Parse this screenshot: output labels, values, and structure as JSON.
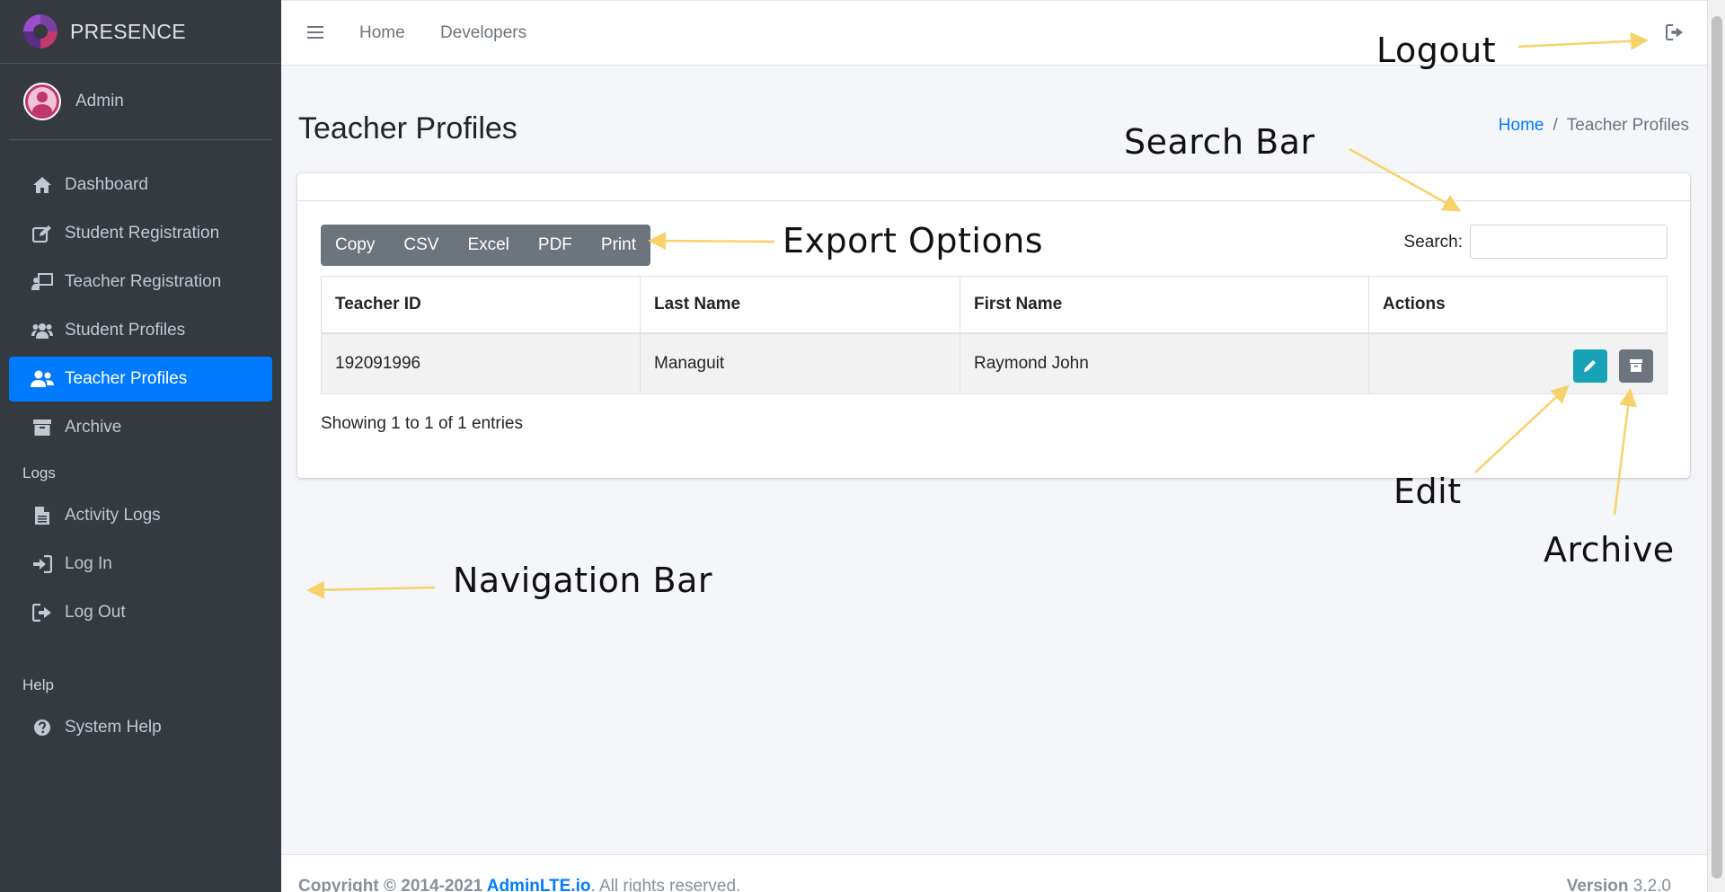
{
  "sidebar": {
    "brand": "PRESENCE",
    "user": "Admin",
    "items": [
      {
        "label": "Dashboard",
        "icon": "home-icon"
      },
      {
        "label": "Student Registration",
        "icon": "edit-icon"
      },
      {
        "label": "Teacher Registration",
        "icon": "chalkboard-teacher-icon"
      },
      {
        "label": "Student Profiles",
        "icon": "users-icon"
      },
      {
        "label": "Teacher Profiles",
        "icon": "user-friends-icon",
        "active": true
      },
      {
        "label": "Archive",
        "icon": "archive-icon"
      }
    ],
    "logs_header": "Logs",
    "logs_items": [
      {
        "label": "Activity Logs",
        "icon": "file-icon"
      },
      {
        "label": "Log In",
        "icon": "sign-in-icon"
      },
      {
        "label": "Log Out",
        "icon": "sign-out-icon"
      }
    ],
    "help_header": "Help",
    "help_items": [
      {
        "label": "System Help",
        "icon": "question-circle-icon"
      }
    ]
  },
  "topbar": {
    "links": [
      "Home",
      "Developers"
    ]
  },
  "page": {
    "title": "Teacher Profiles",
    "breadcrumb": [
      "Home",
      "Teacher Profiles"
    ],
    "breadcrumb_sep": "/"
  },
  "export_buttons": [
    "Copy",
    "CSV",
    "Excel",
    "PDF",
    "Print"
  ],
  "search": {
    "label": "Search:",
    "value": ""
  },
  "table": {
    "headers": [
      "Teacher ID",
      "Last Name",
      "First Name",
      "Actions"
    ],
    "rows": [
      [
        "192091996",
        "Managuit",
        "Raymond John"
      ]
    ]
  },
  "entries_info": "Showing 1 to 1 of 1 entries",
  "footer": {
    "copyright": "Copyright © 2014-2021 ",
    "link": "AdminLTE.io",
    "rest": ". All rights reserved.",
    "version_label": "Version",
    "version": "3.2.0"
  },
  "annotations": {
    "logout": "Logout",
    "search_bar": "Search Bar",
    "export_options": "Export Options",
    "edit": "Edit",
    "archive": "Archive",
    "navigation_bar": "Navigation Bar"
  },
  "colors": {
    "sidebar_bg": "#343a40",
    "active": "#007bff",
    "edit_button": "#17a2b8",
    "archive_button": "#6c757d",
    "annotation_arrow": "#f7d26b"
  }
}
